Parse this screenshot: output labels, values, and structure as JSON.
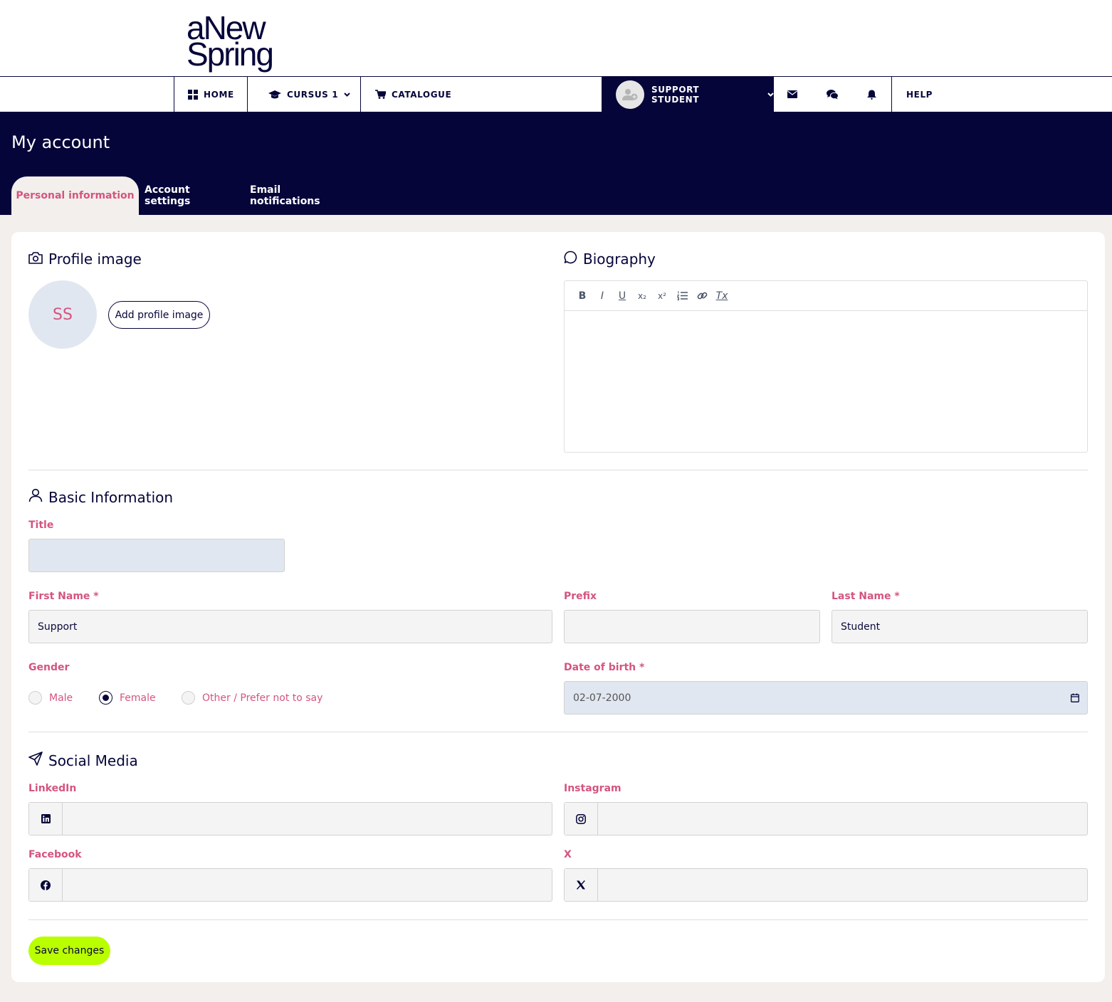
{
  "logo": {
    "line1": "aNew",
    "line2": "Spring"
  },
  "nav": {
    "home": "HOME",
    "course": "CURSUS 1",
    "catalogue": "CATALOGUE",
    "user": "SUPPORT STUDENT",
    "help": "HELP"
  },
  "page": {
    "title": "My account"
  },
  "tabs": [
    "Personal information",
    "Account settings",
    "Email notifications"
  ],
  "profile": {
    "heading": "Profile image",
    "initials": "SS",
    "add_button": "Add profile image"
  },
  "biography": {
    "heading": "Biography",
    "toolbar": [
      "B",
      "I",
      "U",
      "x₂",
      "x²",
      "list",
      "link",
      "Tx"
    ]
  },
  "basic": {
    "heading": "Basic Information",
    "title_label": "Title",
    "title_value": "",
    "first_name_label": "First Name *",
    "first_name_value": "Support",
    "prefix_label": "Prefix",
    "prefix_value": "",
    "last_name_label": "Last Name *",
    "last_name_value": "Student",
    "gender_label": "Gender",
    "gender_options": [
      "Male",
      "Female",
      "Other / Prefer not to say"
    ],
    "gender_selected": "Female",
    "dob_label": "Date of birth *",
    "dob_value": "02-07-2000"
  },
  "social": {
    "heading": "Social Media",
    "linkedin_label": "LinkedIn",
    "instagram_label": "Instagram",
    "facebook_label": "Facebook",
    "x_label": "X"
  },
  "save_button": "Save changes",
  "colors": {
    "navy": "#05053a",
    "pink": "#d4557f",
    "lime": "#baff00"
  }
}
